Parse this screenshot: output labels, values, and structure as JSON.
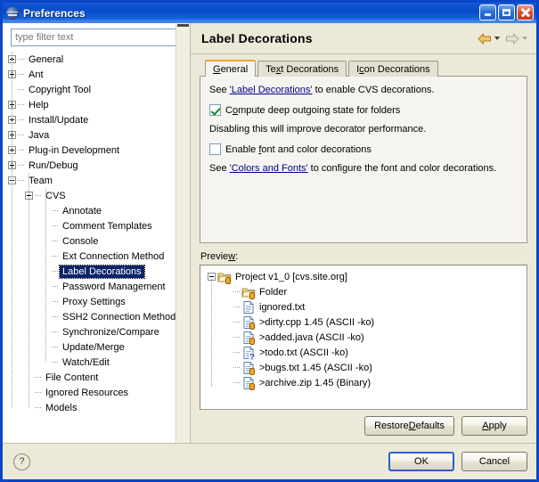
{
  "window": {
    "title": "Preferences",
    "icon": "preferences-icon",
    "caption_buttons": [
      {
        "name": "minimize",
        "label": "_"
      },
      {
        "name": "maximize",
        "label": "□"
      },
      {
        "name": "close",
        "label": "✕"
      }
    ]
  },
  "sidebar": {
    "filter_placeholder": "type filter text",
    "filter_value": "",
    "selected": "Label Decorations",
    "items": [
      {
        "label": "General",
        "depth": 0,
        "expander": "plus"
      },
      {
        "label": "Ant",
        "depth": 0,
        "expander": "plus"
      },
      {
        "label": "Copyright Tool",
        "depth": 0,
        "expander": "none"
      },
      {
        "label": "Help",
        "depth": 0,
        "expander": "plus"
      },
      {
        "label": "Install/Update",
        "depth": 0,
        "expander": "plus"
      },
      {
        "label": "Java",
        "depth": 0,
        "expander": "plus"
      },
      {
        "label": "Plug-in Development",
        "depth": 0,
        "expander": "plus"
      },
      {
        "label": "Run/Debug",
        "depth": 0,
        "expander": "plus"
      },
      {
        "label": "Team",
        "depth": 0,
        "expander": "minus"
      },
      {
        "label": "CVS",
        "depth": 1,
        "expander": "minus"
      },
      {
        "label": "Annotate",
        "depth": 2,
        "expander": "none"
      },
      {
        "label": "Comment Templates",
        "depth": 2,
        "expander": "none"
      },
      {
        "label": "Console",
        "depth": 2,
        "expander": "none"
      },
      {
        "label": "Ext Connection Method",
        "depth": 2,
        "expander": "none"
      },
      {
        "label": "Label Decorations",
        "depth": 2,
        "expander": "none",
        "selected": true
      },
      {
        "label": "Password Management",
        "depth": 2,
        "expander": "none"
      },
      {
        "label": "Proxy Settings",
        "depth": 2,
        "expander": "none"
      },
      {
        "label": "SSH2 Connection Method",
        "depth": 2,
        "expander": "none"
      },
      {
        "label": "Synchronize/Compare",
        "depth": 2,
        "expander": "none"
      },
      {
        "label": "Update/Merge",
        "depth": 2,
        "expander": "none"
      },
      {
        "label": "Watch/Edit",
        "depth": 2,
        "expander": "none"
      },
      {
        "label": "File Content",
        "depth": 1,
        "expander": "none"
      },
      {
        "label": "Ignored Resources",
        "depth": 1,
        "expander": "none"
      },
      {
        "label": "Models",
        "depth": 1,
        "expander": "none"
      }
    ]
  },
  "page": {
    "title": "Label Decorations",
    "nav": {
      "back": {
        "name": "back-arrow-icon",
        "enabled": true
      },
      "back_menu": {
        "name": "back-dropdown-icon",
        "enabled": true
      },
      "forward": {
        "name": "forward-arrow-icon",
        "enabled": false
      },
      "forward_menu": {
        "name": "forward-dropdown-icon",
        "enabled": false
      }
    }
  },
  "tabs": [
    {
      "label": "General",
      "mnemonic": "G",
      "active": true
    },
    {
      "label": "Text Decorations",
      "mnemonic": "x",
      "active": false
    },
    {
      "label": "Icon Decorations",
      "mnemonic": "c",
      "active": false
    }
  ],
  "general_tab": {
    "line1": {
      "before": "See ",
      "link": "'Label Decorations'",
      "after": " to enable CVS decorations."
    },
    "checkbox1": {
      "label_pre": "C",
      "label_mnemonic": "o",
      "label_post": "mpute deep outgoing state for folders",
      "checked": true
    },
    "note": "Disabling this will improve decorator performance.",
    "checkbox2": {
      "label_pre": "Enable ",
      "label_mnemonic": "f",
      "label_post": "ont and color decorations",
      "checked": false
    },
    "line2": {
      "before": "See ",
      "link": "'Colors and Fonts'",
      "after": " to configure the font and color decorations."
    }
  },
  "preview": {
    "label_pre": "Previe",
    "label_mnemonic": "w",
    "label_post": ":",
    "rows": [
      {
        "text": "Project  v1_0 [cvs.site.org]",
        "depth": 0,
        "icon": "folder-project-icon",
        "expander": "minus",
        "badge": "outgoing"
      },
      {
        "text": "Folder",
        "depth": 1,
        "icon": "folder-icon",
        "expander": "none",
        "badge": "outgoing"
      },
      {
        "text": "ignored.txt",
        "depth": 1,
        "icon": "file-icon",
        "expander": "none",
        "badge": "none"
      },
      {
        "text": ">dirty.cpp  1.45  (ASCII -ko)",
        "depth": 1,
        "icon": "file-icon",
        "expander": "none",
        "badge": "outgoing"
      },
      {
        "text": ">added.java   (ASCII -ko)",
        "depth": 1,
        "icon": "file-icon",
        "expander": "none",
        "badge": "outgoing"
      },
      {
        "text": ">todo.txt   (ASCII -ko)",
        "depth": 1,
        "icon": "file-icon",
        "expander": "none",
        "badge": "question"
      },
      {
        "text": ">bugs.txt  1.45  (ASCII -ko)",
        "depth": 1,
        "icon": "file-icon",
        "expander": "none",
        "badge": "outgoing"
      },
      {
        "text": ">archive.zip  1.45  (Binary)",
        "depth": 1,
        "icon": "file-icon",
        "expander": "none",
        "badge": "outgoing"
      }
    ]
  },
  "buttons": {
    "restore_defaults": {
      "pre": "Restore ",
      "mnemonic": "D",
      "post": "efaults"
    },
    "apply": {
      "pre": "",
      "mnemonic": "A",
      "post": "pply"
    },
    "ok": "OK",
    "cancel": "Cancel",
    "help_icon": "?"
  },
  "colors": {
    "titlebar_blue": "#0A4CCB",
    "window_border": "#0A46C8",
    "dialog_bg": "#ECE9D8",
    "panel_bg": "#F5F4F0",
    "selection": "#0A246A",
    "link": "#00008B",
    "active_tab_top": "#E8A33D",
    "check_green": "#128A2C"
  }
}
